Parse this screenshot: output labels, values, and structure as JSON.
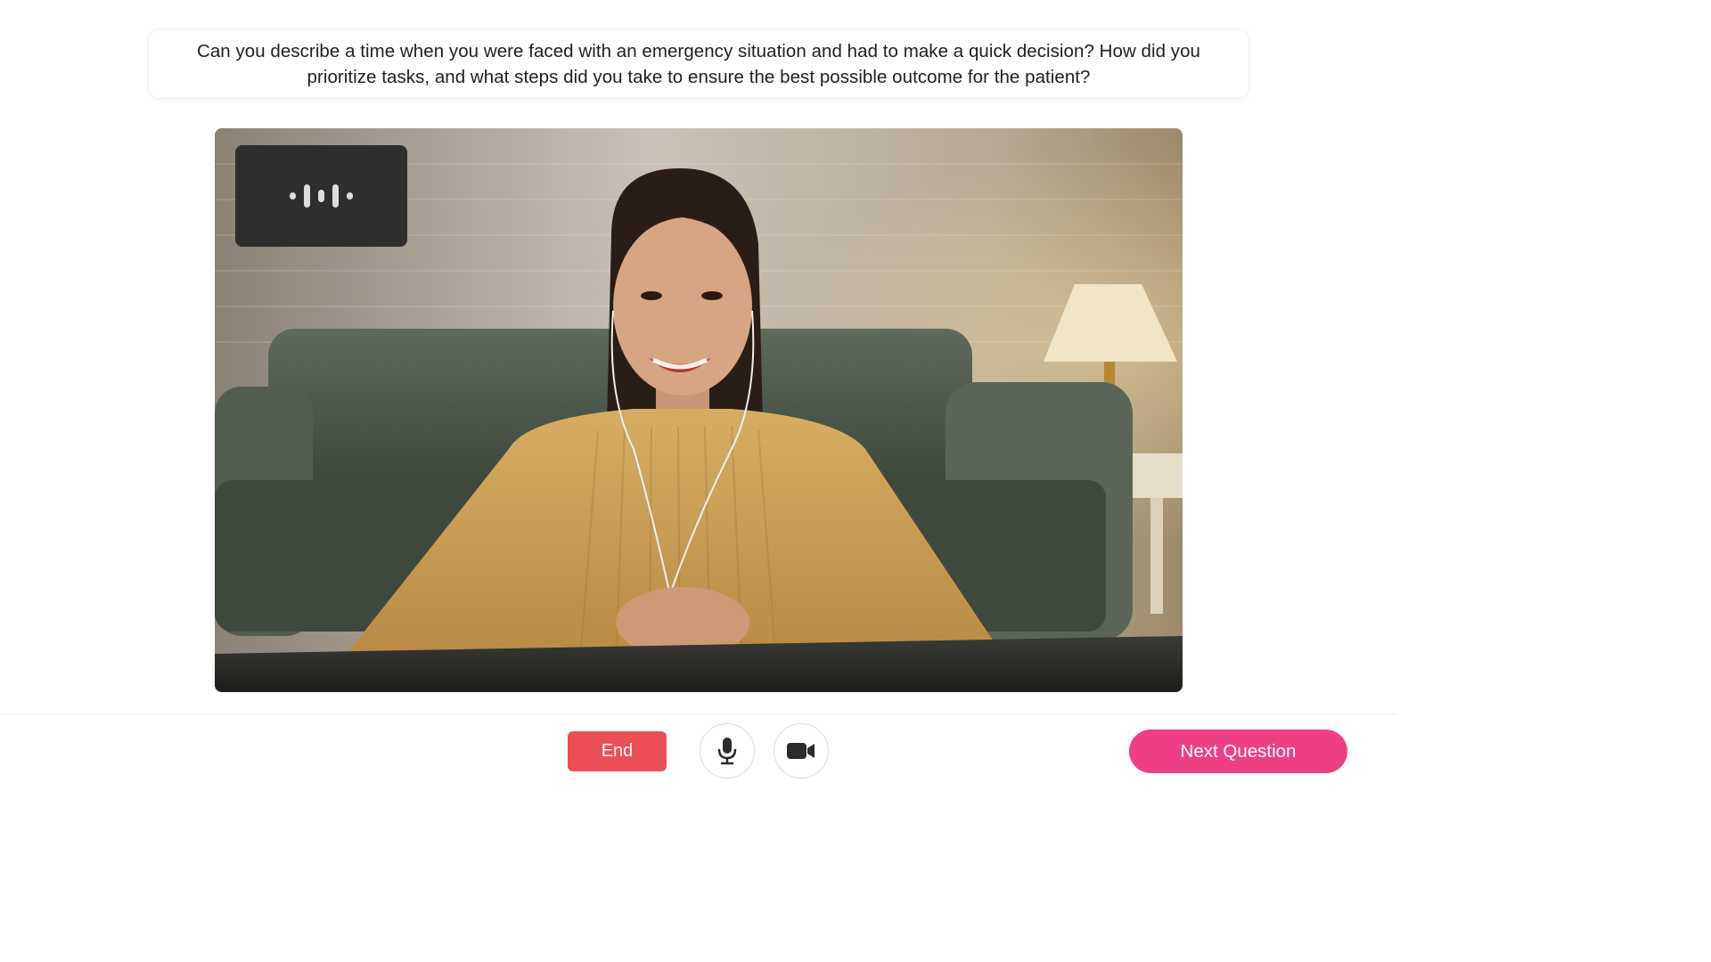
{
  "question": {
    "text": "Can you describe a time when you were faced with an emergency situation and had to make a quick decision? How did you prioritize tasks, and what steps did you take to ensure the best possible outcome for the patient?"
  },
  "controls": {
    "end_label": "End",
    "next_label": "Next Question"
  },
  "icons": {
    "speaker": "audio-waveform-icon",
    "mic": "microphone-icon",
    "camera": "video-camera-icon"
  },
  "colors": {
    "end_button": "#ec4e55",
    "next_button": "#ee3f86",
    "speaker_tile": "#2e2e2e"
  }
}
